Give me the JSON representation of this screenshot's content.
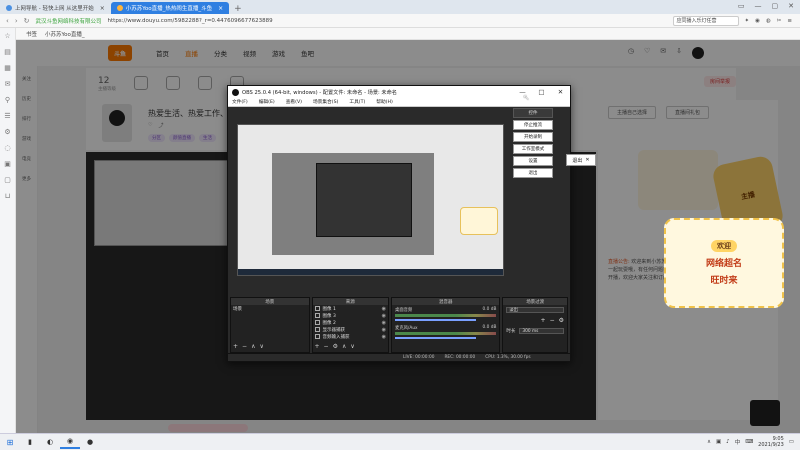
{
  "browser": {
    "tabs": [
      {
        "label": "上网导航 - 轻快上网 从这里开始",
        "active": false
      },
      {
        "label": "小苏苏Yoo直播_热热闹生直播_斗鱼",
        "active": true
      }
    ],
    "new_tab": "+",
    "window_controls": [
      "▭",
      "—",
      "▢",
      "✕"
    ],
    "nav_back": "‹",
    "nav_forward": "›",
    "nav_refresh": "↻",
    "secure_label": "武汉斗鱼网络科技有限公司",
    "url": "https://www.douyu.com/5982288?_r=0.4476096677623889",
    "search_placeholder": "在此搜索",
    "search_text": "应同播入乐灯任营"
  },
  "bookmarks": {
    "items": [
      "书签",
      "小苏苏Yoo直播_"
    ]
  },
  "left_sidebar_icons": [
    "star-icon",
    "doc-icon",
    "grid-icon",
    "mail-icon",
    "search-icon",
    "list-icon",
    "gear-icon",
    "chat-icon",
    "calendar-icon",
    "lock-icon",
    "cart-icon"
  ],
  "douyu": {
    "logo": "斗鱼",
    "nav": [
      {
        "label": "首页",
        "current": false
      },
      {
        "label": "直播",
        "current": true
      },
      {
        "label": "分类",
        "current": false
      },
      {
        "label": "视频",
        "current": false
      },
      {
        "label": "游戏",
        "current": false
      },
      {
        "label": "鱼吧",
        "current": false
      }
    ],
    "side_labels": [
      "关注",
      "历史",
      "排行",
      "游戏",
      "电竞",
      "更多"
    ],
    "room": {
      "level": "12",
      "level_caption": "主播等级",
      "slogan": "热爱生活、热爱工作、努力",
      "tags": [
        "分区",
        "颜值直播",
        "生活"
      ],
      "report_label": "房间举报"
    },
    "right_buttons": [
      "主播自己选择",
      "直播间礼包"
    ],
    "notice_title": "直播公告:",
    "notice_text": "欢迎来到小苏苏Yoo的直播间，要和我一起玩耍哦，有任何问题可以留言给我，每天准时开播，欢迎大家关注和订阅哦。",
    "character_text": "主播",
    "sticker": {
      "line1": "欢迎",
      "line2": "网络超名",
      "line3": "旺时来"
    }
  },
  "obs": {
    "title": "OBS 25.0.4 (64-bit, windows) - 配置文件: 未命名 - 场景: 未命名",
    "window_controls": [
      "—",
      "□",
      "✕"
    ],
    "menu": [
      "文件(F)",
      "编辑(E)",
      "查看(V)",
      "场景集合(S)",
      "工具(T)",
      "帮助(H)"
    ],
    "controls": [
      {
        "label": "控件",
        "highlight": false
      },
      {
        "label": "停止推流",
        "highlight": true
      },
      {
        "label": "开始录制",
        "highlight": true
      },
      {
        "label": "工作室模式",
        "highlight": true
      },
      {
        "label": "设置",
        "highlight": true
      },
      {
        "label": "退出",
        "highlight": true
      }
    ],
    "exit_popup": "退出",
    "docks": {
      "scenes": {
        "title": "场景",
        "items": [
          "场景"
        ]
      },
      "sources": {
        "title": "来源",
        "items": [
          "图像 1",
          "图像 3",
          "图像 2",
          "显示器捕获",
          "音频输入捕获"
        ]
      },
      "mixer": {
        "title": "混音器",
        "rows": [
          {
            "label": "桌面音频",
            "db": "0.0 dB"
          },
          {
            "label": "麦克风/Aux",
            "db": "0.0 dB"
          }
        ]
      },
      "transitions": {
        "title": "场景过渡",
        "type": "淡出",
        "duration_label": "时长",
        "duration": "300 ms"
      }
    },
    "status": {
      "live": "LIVE: 00:00:00",
      "rec": "REC: 00:00:00",
      "cpu": "CPU: 1.3%, 30.00 fps"
    }
  },
  "taskbar": {
    "apps": [
      "start-icon",
      "chart-app-icon",
      "obs-app-icon",
      "browser-app-icon",
      "obs2-app-icon"
    ],
    "tray": [
      "∧",
      "▣",
      "♪",
      "中",
      "⌨"
    ],
    "time": "9:05",
    "date": "2021/9/23"
  }
}
